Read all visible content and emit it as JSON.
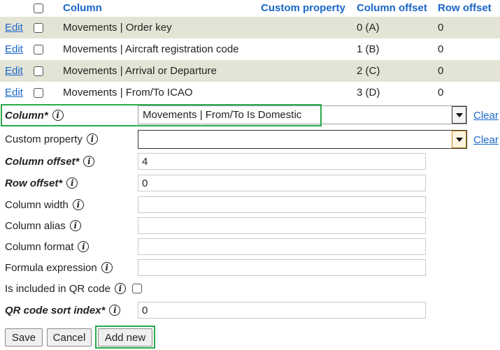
{
  "grid": {
    "headers": {
      "column": "Column",
      "custom_property": "Custom property",
      "column_offset": "Column offset",
      "row_offset": "Row offset"
    },
    "edit_label": "Edit",
    "rows": [
      {
        "column": "Movements | Order key",
        "column_offset": "0 (A)",
        "row_offset": "0"
      },
      {
        "column": "Movements | Aircraft registration code",
        "column_offset": "1 (B)",
        "row_offset": "0"
      },
      {
        "column": "Movements | Arrival or Departure",
        "column_offset": "2 (C)",
        "row_offset": "0"
      },
      {
        "column": "Movements | From/To ICAO",
        "column_offset": "3 (D)",
        "row_offset": "0"
      }
    ]
  },
  "form": {
    "column": {
      "label": "Column*",
      "value": "Movements | From/To Is Domestic",
      "clear": "Clear"
    },
    "custom_property": {
      "label": "Custom property",
      "value": "",
      "clear": "Clear"
    },
    "column_offset": {
      "label": "Column offset*",
      "value": "4"
    },
    "row_offset": {
      "label": "Row offset*",
      "value": "0"
    },
    "column_width": {
      "label": "Column width",
      "value": ""
    },
    "column_alias": {
      "label": "Column alias",
      "value": ""
    },
    "column_format": {
      "label": "Column format",
      "value": ""
    },
    "formula_expression": {
      "label": "Formula expression",
      "value": ""
    },
    "is_included_qr": {
      "label": "Is included in QR code"
    },
    "qr_sort_index": {
      "label": "QR code sort index*",
      "value": "0"
    }
  },
  "buttons": {
    "save": "Save",
    "cancel": "Cancel",
    "add_new": "Add new"
  },
  "icons": {
    "info": "info-icon",
    "dropdown": "chevron-down-icon"
  },
  "colors": {
    "link": "#1a66c9",
    "alt_row": "#e4e4d6",
    "highlight": "#2aa84a"
  }
}
